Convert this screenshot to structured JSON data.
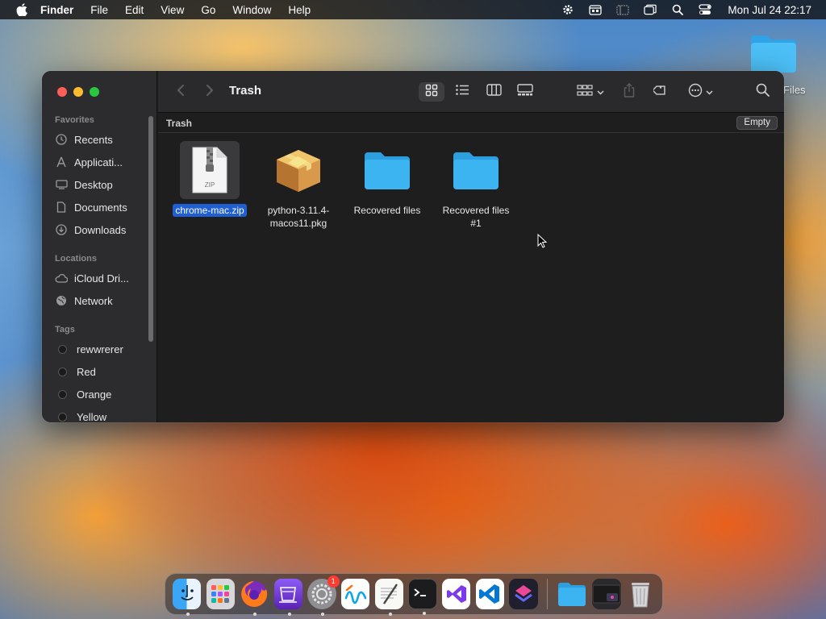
{
  "menubar": {
    "app_name": "Finder",
    "menus": [
      "File",
      "Edit",
      "View",
      "Go",
      "Window",
      "Help"
    ],
    "clock": "Mon Jul 24  22:17",
    "status_icons": [
      "gear-icon",
      "calendar-icon",
      "sidebar-icon",
      "window-icon",
      "search-icon",
      "control-center-icon"
    ]
  },
  "desktop": {
    "folder_label": "Files"
  },
  "window": {
    "title": "Trash",
    "path_label": "Trash",
    "empty_button": "Empty",
    "sidebar": {
      "favorites_header": "Favorites",
      "favorites": [
        {
          "label": "Recents",
          "icon": "clock-icon"
        },
        {
          "label": "Applicati...",
          "icon": "applications-icon"
        },
        {
          "label": "Desktop",
          "icon": "desktop-icon"
        },
        {
          "label": "Documents",
          "icon": "document-icon"
        },
        {
          "label": "Downloads",
          "icon": "download-icon"
        }
      ],
      "locations_header": "Locations",
      "locations": [
        {
          "label": "iCloud Dri...",
          "icon": "cloud-icon"
        },
        {
          "label": "Network",
          "icon": "globe-icon"
        }
      ],
      "tags_header": "Tags",
      "tags": [
        "rewwrerer",
        "Red",
        "Orange",
        "Yellow"
      ]
    },
    "files": [
      {
        "name": "chrome-mac.zip",
        "type": "zip",
        "selected": true,
        "zip_label": "ZIP"
      },
      {
        "name_line1": "python-3.11.4-",
        "name_line2": "macos11.pkg",
        "type": "package"
      },
      {
        "name": "Recovered files",
        "type": "folder"
      },
      {
        "name_line1": "Recovered files",
        "name_line2": "#1",
        "type": "folder"
      }
    ]
  },
  "dock": {
    "apps": [
      "finder-icon",
      "launchpad-icon",
      "firefox-icon",
      "simulator-icon",
      "system-settings-icon",
      "freeform-icon",
      "textedit-icon",
      "terminal-icon",
      "visual-studio-icon",
      "vscode-icon",
      "shortcuts-icon",
      "downloads-folder-icon",
      "minimized-window-icon",
      "trash-icon"
    ],
    "settings_badge": "1"
  },
  "colors": {
    "selection": "#1f5fd1",
    "folder": "#3db4f2"
  }
}
